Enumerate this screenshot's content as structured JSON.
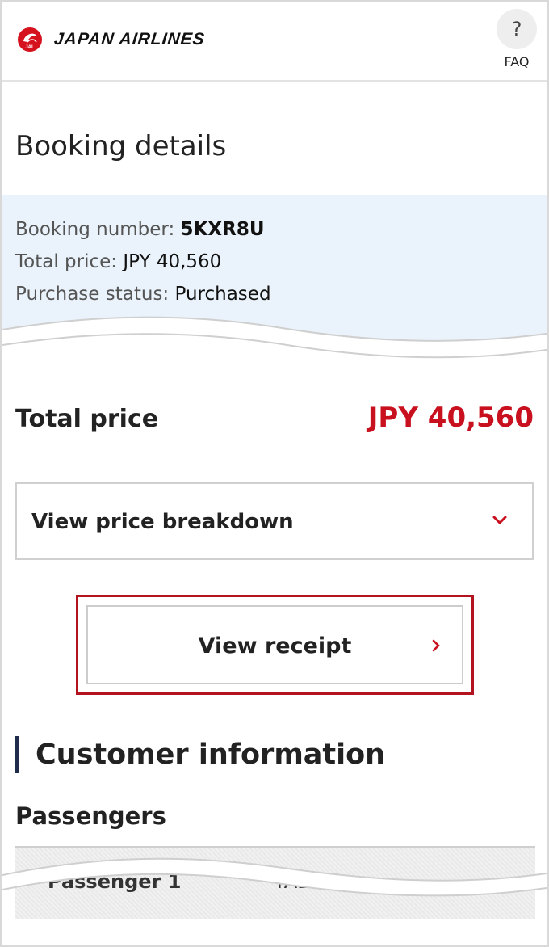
{
  "header": {
    "logo_text": "JAPAN AIRLINES",
    "faq_icon": "?",
    "faq_label": "FAQ"
  },
  "page_title": "Booking details",
  "summary": {
    "booking_number_label": "Booking number: ",
    "booking_number": "5KXR8U",
    "total_price_label": "Total price: ",
    "total_price": "JPY 40,560",
    "status_label": "Purchase status: ",
    "status": "Purchased"
  },
  "total": {
    "label": "Total price",
    "value": "JPY 40,560"
  },
  "breakdown": {
    "label": "View price breakdown",
    "icon": "chevron-down-icon"
  },
  "receipt": {
    "label": "View receipt",
    "icon": "chevron-right-icon"
  },
  "customer": {
    "title": "Customer information",
    "passengers_title": "Passengers",
    "row_label": "Passenger 1",
    "row_name": "TABITO"
  },
  "colors": {
    "accent_red": "#c8101e",
    "summary_bg": "#eaf3fb",
    "section_bar": "#1f2b4a"
  }
}
